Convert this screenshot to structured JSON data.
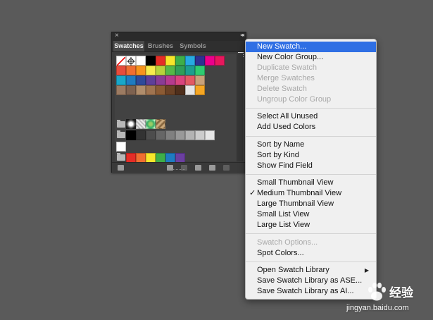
{
  "panel": {
    "close_icon": "×",
    "collapse_icon": "◂◂",
    "tabs": [
      {
        "label": "Swatches",
        "active": true
      },
      {
        "label": "Brushes",
        "active": false
      },
      {
        "label": "Symbols",
        "active": false
      }
    ],
    "swatch_colors": {
      "row1": [
        "#ffffff",
        "#000000",
        "#e52d27",
        "#f7e62b",
        "#3eae49",
        "#27aae1",
        "#2e3192",
        "#ec008c",
        "#e8175d"
      ],
      "row2": [
        "#e74c3c",
        "#f06e31",
        "#f7941d",
        "#f8ec4d",
        "#b7d33b",
        "#55b947",
        "#2f9e58",
        "#1c9e8f",
        "#2ecc71"
      ],
      "row3": [
        "#19a7c9",
        "#1f7bc1",
        "#2e4a9b",
        "#5e3f99",
        "#8a3c95",
        "#b63b8e",
        "#d9457e",
        "#e25a64",
        "#c8a17a"
      ],
      "row4": [
        "#9c7b62",
        "#7e6250",
        "#b08d6c",
        "#a07450",
        "#8c5b34",
        "#6b4226",
        "#4f2f1c",
        "#e6e6e6",
        "#f5a623"
      ],
      "row6": [
        "#000000",
        "#333333",
        "#4d4d4d",
        "#666666",
        "#808080",
        "#999999",
        "#b3b3b3",
        "#cccccc",
        "#e6e6e6"
      ],
      "row7": [
        "#ffffff"
      ],
      "row8": [
        "#e52d27",
        "#f06e31",
        "#f7e62b",
        "#3eae49",
        "#1f7bc1",
        "#6b3fa0"
      ]
    }
  },
  "menu": {
    "group1": [
      {
        "label": "New Swatch...",
        "disabled": false,
        "highlighted": true
      },
      {
        "label": "New Color Group...",
        "disabled": false
      },
      {
        "label": "Duplicate Swatch",
        "disabled": true
      },
      {
        "label": "Merge Swatches",
        "disabled": true
      },
      {
        "label": "Delete Swatch",
        "disabled": true
      },
      {
        "label": "Ungroup Color Group",
        "disabled": true
      }
    ],
    "group2": [
      {
        "label": "Select All Unused",
        "disabled": false
      },
      {
        "label": "Add Used Colors",
        "disabled": false
      }
    ],
    "group3": [
      {
        "label": "Sort by Name",
        "disabled": false
      },
      {
        "label": "Sort by Kind",
        "disabled": false
      },
      {
        "label": "Show Find Field",
        "disabled": false
      }
    ],
    "group4": [
      {
        "label": "Small Thumbnail View",
        "checked": false
      },
      {
        "label": "Medium Thumbnail View",
        "checked": true
      },
      {
        "label": "Large Thumbnail View",
        "checked": false
      },
      {
        "label": "Small List View",
        "checked": false
      },
      {
        "label": "Large List View",
        "checked": false
      }
    ],
    "group5": [
      {
        "label": "Swatch Options...",
        "disabled": true
      },
      {
        "label": "Spot Colors...",
        "disabled": false
      }
    ],
    "group6": [
      {
        "label": "Open Swatch Library",
        "submenu": true
      },
      {
        "label": "Save Swatch Library as ASE..."
      },
      {
        "label": "Save Swatch Library as AI..."
      }
    ],
    "check_glyph": "✓",
    "submenu_glyph": "▶"
  },
  "watermark": {
    "brand": "经验",
    "url": "jingyan.baidu.com"
  }
}
